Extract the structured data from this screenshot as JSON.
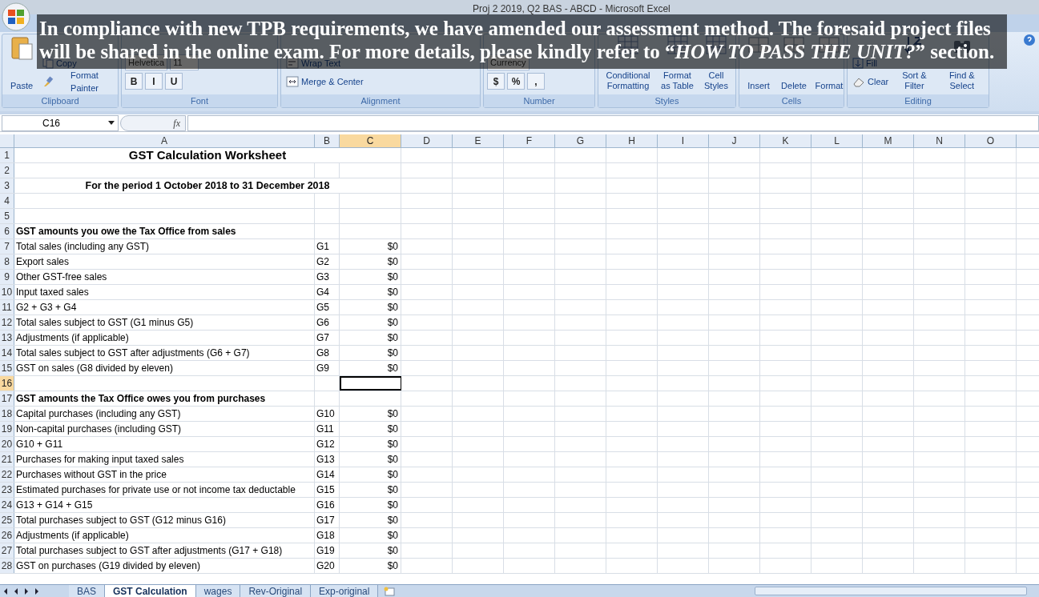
{
  "window": {
    "title": "Proj 2 2019, Q2 BAS - ABCD - Microsoft Excel"
  },
  "overlay_caption": "In compliance with new TPB requirements, we have amended our assessment method. The foresaid project files will be shared in the online exam. For more details, please kindly refer to “*HOW TO PASS THE UNIT?*” section.",
  "ribbon": {
    "groups": [
      {
        "label": "Clipboard",
        "large": [
          {
            "label": "Paste"
          }
        ],
        "lines": [
          [
            {
              "kind": "small",
              "label": "Copy"
            }
          ],
          [
            {
              "kind": "small",
              "label": "Format Painter"
            }
          ]
        ]
      },
      {
        "label": "Font",
        "lines": [
          [
            {
              "kind": "field",
              "label": "Helvetica"
            },
            {
              "kind": "field",
              "label": "11"
            }
          ],
          [
            {
              "kind": "toggle",
              "label": "B"
            },
            {
              "kind": "toggle",
              "label": "I"
            },
            {
              "kind": "toggle",
              "label": "U"
            }
          ]
        ]
      },
      {
        "label": "Alignment",
        "lines": [
          [
            {
              "kind": "small",
              "label": "Wrap Text"
            }
          ],
          [
            {
              "kind": "small",
              "label": "Merge & Center"
            }
          ]
        ]
      },
      {
        "label": "Number",
        "lines": [
          [
            {
              "kind": "field",
              "label": "Currency"
            }
          ],
          [
            {
              "kind": "toggle",
              "label": "$"
            },
            {
              "kind": "toggle",
              "label": "%"
            },
            {
              "kind": "toggle",
              "label": ","
            }
          ]
        ]
      },
      {
        "label": "Styles",
        "large": [
          {
            "label": "Conditional Formatting"
          },
          {
            "label": "Format as Table"
          },
          {
            "label": "Cell Styles"
          }
        ]
      },
      {
        "label": "Cells",
        "large": [
          {
            "label": "Insert"
          },
          {
            "label": "Delete"
          },
          {
            "label": "Format"
          }
        ]
      },
      {
        "label": "Editing",
        "large": [
          {
            "label": "Sort & Filter"
          },
          {
            "label": "Find & Select"
          }
        ],
        "lines": [
          [
            {
              "kind": "small",
              "label": "Fill"
            }
          ],
          [
            {
              "kind": "small",
              "label": "Clear"
            }
          ]
        ]
      }
    ]
  },
  "formula_bar": {
    "name_box": "C16",
    "fx": "fx"
  },
  "sheet": {
    "columns": [
      {
        "label": "A",
        "selected": false
      },
      {
        "label": "B",
        "selected": false
      },
      {
        "label": "C",
        "selected": true
      },
      {
        "label": "D",
        "selected": false
      },
      {
        "label": "E",
        "selected": false
      },
      {
        "label": "F",
        "selected": false
      },
      {
        "label": "G",
        "selected": false
      },
      {
        "label": "H",
        "selected": false
      },
      {
        "label": "I",
        "selected": false
      },
      {
        "label": "J",
        "selected": false
      },
      {
        "label": "K",
        "selected": false
      },
      {
        "label": "L",
        "selected": false
      },
      {
        "label": "M",
        "selected": false
      },
      {
        "label": "N",
        "selected": false
      },
      {
        "label": "O",
        "selected": false
      }
    ],
    "rows": [
      {
        "number": "1",
        "selected": false,
        "kind": "title",
        "text": "GST Calculation Worksheet"
      },
      {
        "number": "2",
        "selected": false,
        "kind": "empty"
      },
      {
        "number": "3",
        "selected": false,
        "kind": "subtitle",
        "text": "For the period 1 October 2018 to 31 December 2018"
      },
      {
        "number": "4",
        "selected": false,
        "kind": "empty"
      },
      {
        "number": "5",
        "selected": false,
        "kind": "empty"
      },
      {
        "number": "6",
        "selected": false,
        "kind": "heading",
        "text": "GST amounts you owe the Tax Office from sales"
      },
      {
        "number": "7",
        "selected": false,
        "kind": "line",
        "cells": [
          "Total sales (including any GST)",
          "G1",
          "$0"
        ]
      },
      {
        "number": "8",
        "selected": false,
        "kind": "line",
        "cells": [
          "Export sales",
          "G2",
          "$0"
        ]
      },
      {
        "number": "9",
        "selected": false,
        "kind": "line",
        "cells": [
          "Other GST-free sales",
          "G3",
          "$0"
        ]
      },
      {
        "number": "10",
        "selected": false,
        "kind": "line",
        "cells": [
          "Input taxed sales",
          "G4",
          "$0"
        ]
      },
      {
        "number": "11",
        "selected": false,
        "kind": "line",
        "cells": [
          "G2 + G3 + G4",
          "G5",
          "$0"
        ]
      },
      {
        "number": "12",
        "selected": false,
        "kind": "line",
        "cells": [
          "Total sales subject to GST (G1 minus G5)",
          "G6",
          "$0"
        ]
      },
      {
        "number": "13",
        "selected": false,
        "kind": "line",
        "cells": [
          "Adjustments (if applicable)",
          "G7",
          "$0"
        ]
      },
      {
        "number": "14",
        "selected": false,
        "kind": "line",
        "cells": [
          "Total sales subject to GST after adjustments (G6 + G7)",
          "G8",
          "$0"
        ]
      },
      {
        "number": "15",
        "selected": false,
        "kind": "line",
        "cells": [
          "GST on sales (G8 divided by eleven)",
          "G9",
          "$0"
        ]
      },
      {
        "number": "16",
        "selected": true,
        "kind": "empty"
      },
      {
        "number": "17",
        "selected": false,
        "kind": "heading",
        "text": "GST amounts the Tax Office owes you from purchases"
      },
      {
        "number": "18",
        "selected": false,
        "kind": "line",
        "cells": [
          "Capital purchases (including any GST)",
          "G10",
          "$0"
        ]
      },
      {
        "number": "19",
        "selected": false,
        "kind": "line",
        "cells": [
          "Non-capital purchases (including GST)",
          "G11",
          "$0"
        ]
      },
      {
        "number": "20",
        "selected": false,
        "kind": "line",
        "cells": [
          "G10 + G11",
          "G12",
          "$0"
        ]
      },
      {
        "number": "21",
        "selected": false,
        "kind": "line",
        "cells": [
          "Purchases for making input taxed sales",
          "G13",
          "$0"
        ]
      },
      {
        "number": "22",
        "selected": false,
        "kind": "line",
        "cells": [
          "Purchases without GST in the price",
          "G14",
          "$0"
        ]
      },
      {
        "number": "23",
        "selected": false,
        "kind": "line",
        "cells": [
          "Estimated purchases for private use or not income tax deductable",
          "G15",
          "$0"
        ]
      },
      {
        "number": "24",
        "selected": false,
        "kind": "line",
        "cells": [
          "G13 + G14 + G15",
          "G16",
          "$0"
        ]
      },
      {
        "number": "25",
        "selected": false,
        "kind": "line",
        "cells": [
          "Total purchases subject to GST (G12 minus G16)",
          "G17",
          "$0"
        ]
      },
      {
        "number": "26",
        "selected": false,
        "kind": "line",
        "cells": [
          "Adjustments (if applicable)",
          "G18",
          "$0"
        ]
      },
      {
        "number": "27",
        "selected": false,
        "kind": "line",
        "cells": [
          "Total purchases subject to GST after adjustments (G17 + G18)",
          "G19",
          "$0"
        ]
      },
      {
        "number": "28",
        "selected": false,
        "kind": "line",
        "cells": [
          "GST on purchases (G19 divided by eleven)",
          "G20",
          "$0"
        ]
      }
    ]
  },
  "sheet_tabs": [
    {
      "label": "BAS",
      "selected": false
    },
    {
      "label": "GST Calculation",
      "selected": true
    },
    {
      "label": "wages",
      "selected": false
    },
    {
      "label": "Rev-Original",
      "selected": false
    },
    {
      "label": "Exp-original",
      "selected": false
    }
  ]
}
